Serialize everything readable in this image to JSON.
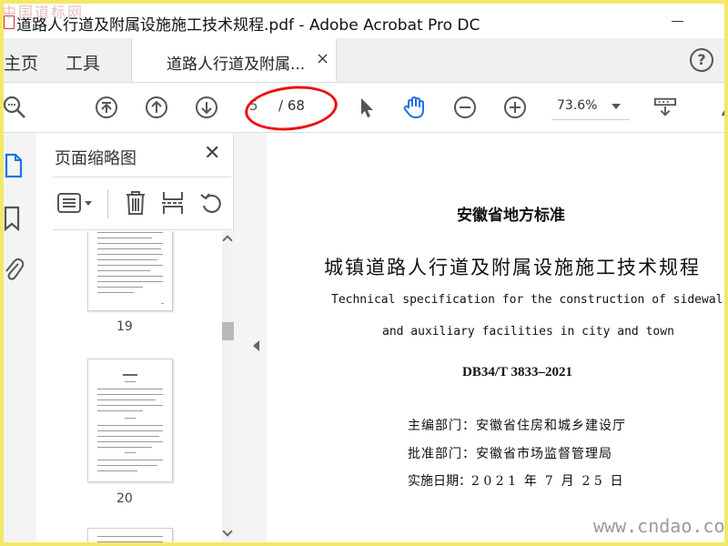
{
  "watermark_top": "中国道标网",
  "window": {
    "title": "道路人行道及附属设施施工技术规程.pdf - Adobe Acrobat Pro DC"
  },
  "tabs": {
    "home": "主页",
    "tools": "工具",
    "document": "道路人行道及附属...",
    "close_glyph": "×"
  },
  "help_glyph": "?",
  "toolbar": {
    "page_current": "5",
    "page_total": "/ 68",
    "zoom": "73.6%"
  },
  "thumbnail_panel": {
    "title": "页面缩略图",
    "close_glyph": "✕",
    "pages": [
      "19",
      "20"
    ]
  },
  "document": {
    "standard_org": "安徽省地方标准",
    "title_cn": "城镇道路人行道及附属设施施工技术规程",
    "title_en_line1": "Technical specification for the construction of sidewalk",
    "title_en_line2": "and auxiliary facilities in city and town",
    "code": "DB34/T 3833–2021",
    "editor": "主编部门：安徽省住房和城乡建设厅",
    "approver": "批准部门：安徽省市场监督管理局",
    "effective": "实施日期：2 0 2 1  年  7  月  2 5  日"
  },
  "watermark_bottom": "www.cndao.com",
  "colors": {
    "frame": "#f2e96a",
    "accent_blue": "#1a73e8",
    "oval_red": "#e11111"
  }
}
